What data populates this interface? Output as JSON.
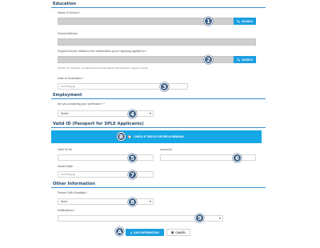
{
  "education": {
    "heading": "Education",
    "school_label": "Name of School *",
    "school_address_label": "School Address",
    "degree_label": "Degree/Course related to the examination you're applying applied for *",
    "degree_note": "(NOTE: For Teachers, LE-data owners should specify their bachelor's degree course)",
    "graduation_label": "Date of Graduation *",
    "graduation_placeholder": "mm/dd/yyyy",
    "search_label": "SEARCH"
  },
  "employment": {
    "heading": "Employment",
    "profession_label": "Are you practicing your profession? *",
    "profession_value": "Select"
  },
  "valid_id": {
    "heading": "Valid ID (Passport for SPLE Applicants)",
    "banner_label": "CHECK IF THIS IS FOR PRE-ID RENEWAL",
    "id_no_label": "Valid ID No.",
    "issued_at_label": "Issued At",
    "issued_date_label": "Issued Date",
    "issued_date_placeholder": "mm/dd/yyyy"
  },
  "other": {
    "heading": "Other Information",
    "pwd_label": "Person With Disability *",
    "pwd_value": "None",
    "notification_label": "Notifications *"
  },
  "actions": {
    "save_label": "SAVE INFORMATION",
    "cancel_label": "CANCEL"
  },
  "markers": [
    "1",
    "2",
    "3",
    "4",
    "5",
    "6",
    "7",
    "8",
    "9",
    "A",
    "B"
  ],
  "colors": {
    "accent": "#1a9ee0",
    "section_heading": "#2b4a6b",
    "marker": "#3d5f85"
  }
}
